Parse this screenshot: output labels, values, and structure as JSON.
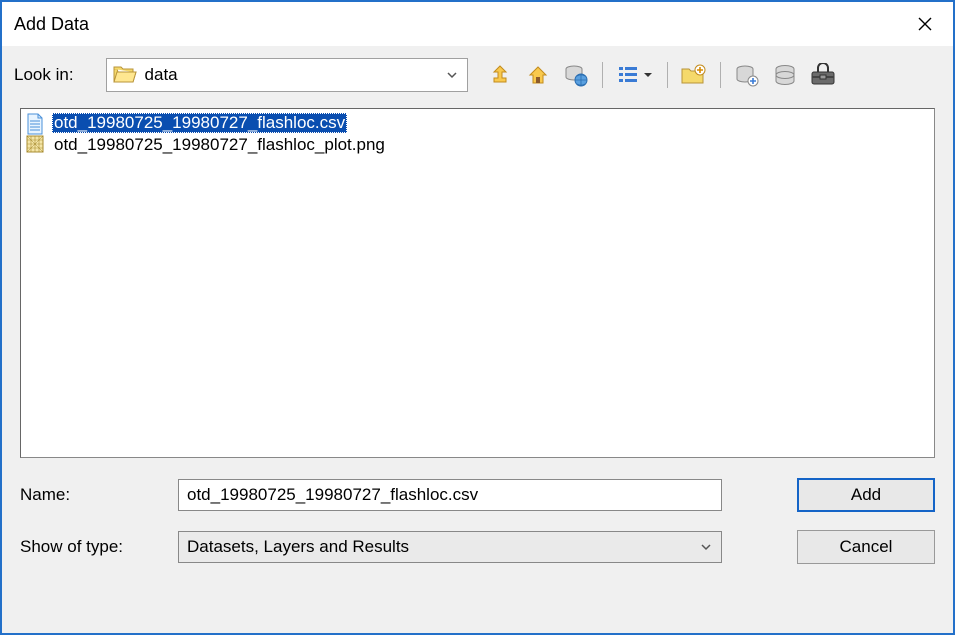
{
  "title": "Add Data",
  "lookin": {
    "label": "Look in:",
    "value": "data"
  },
  "files": [
    {
      "name": "otd_19980725_19980727_flashloc.csv",
      "icon": "csv",
      "selected": true
    },
    {
      "name": "otd_19980725_19980727_flashloc_plot.png",
      "icon": "png",
      "selected": false
    }
  ],
  "name_field": {
    "label": "Name:",
    "value": "otd_19980725_19980727_flashloc.csv"
  },
  "type_field": {
    "label": "Show of type:",
    "value": "Datasets, Layers and Results"
  },
  "buttons": {
    "add": "Add",
    "cancel": "Cancel"
  }
}
